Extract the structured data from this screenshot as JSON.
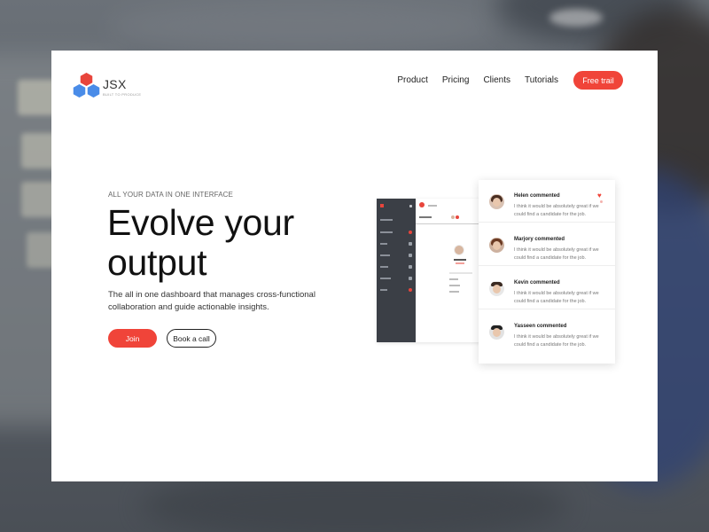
{
  "brand": {
    "name": "JSX",
    "tagline": "BUILT TO PRODUCE",
    "accent_color": "#f04439",
    "logo_colors": [
      "#e8453c",
      "#4a8ce8"
    ]
  },
  "nav": {
    "items": [
      {
        "label": "Product"
      },
      {
        "label": "Pricing"
      },
      {
        "label": "Clients"
      },
      {
        "label": "Tutorials"
      }
    ],
    "cta_label": "Free trail"
  },
  "hero": {
    "eyebrow": "ALL YOUR DATA IN ONE INTERFACE",
    "headline_line1": "Evolve your",
    "headline_line2": "output",
    "description": "The all in one dashboard that manages cross-functional collaboration and guide actionable insights.",
    "primary_button": "Join",
    "secondary_button": "Book a call"
  },
  "comments": [
    {
      "name": "Helen commented",
      "text": "I think it would be absolutely great if we could find a candidate for the job.",
      "liked": true
    },
    {
      "name": "Marjory commented",
      "text": "I think it would be absolutely great if we could find a candidate for the job.",
      "liked": false
    },
    {
      "name": "Kevin commented",
      "text": "I think it would be absolutely great if we could find a candidate for the job.",
      "liked": false
    },
    {
      "name": "Yasseen commented",
      "text": "I think it would be absolutely great if we could find a candidate for the job.",
      "liked": false
    }
  ]
}
